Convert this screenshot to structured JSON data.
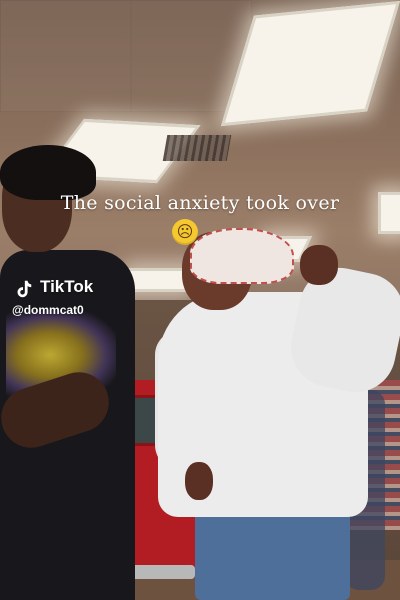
{
  "video": {
    "caption": "The social anxiety took over",
    "caption_emoji_icon": "crying-face-emoji-icon"
  },
  "watermark": {
    "logo_icon": "tiktok-logo-icon",
    "brand": "TikTok",
    "handle": "@dommcat0"
  },
  "colors": {
    "caption_text": "#ffffff",
    "truck": "#b21c23",
    "sweater": "#ececec",
    "jeans": "#4e6f9a"
  }
}
